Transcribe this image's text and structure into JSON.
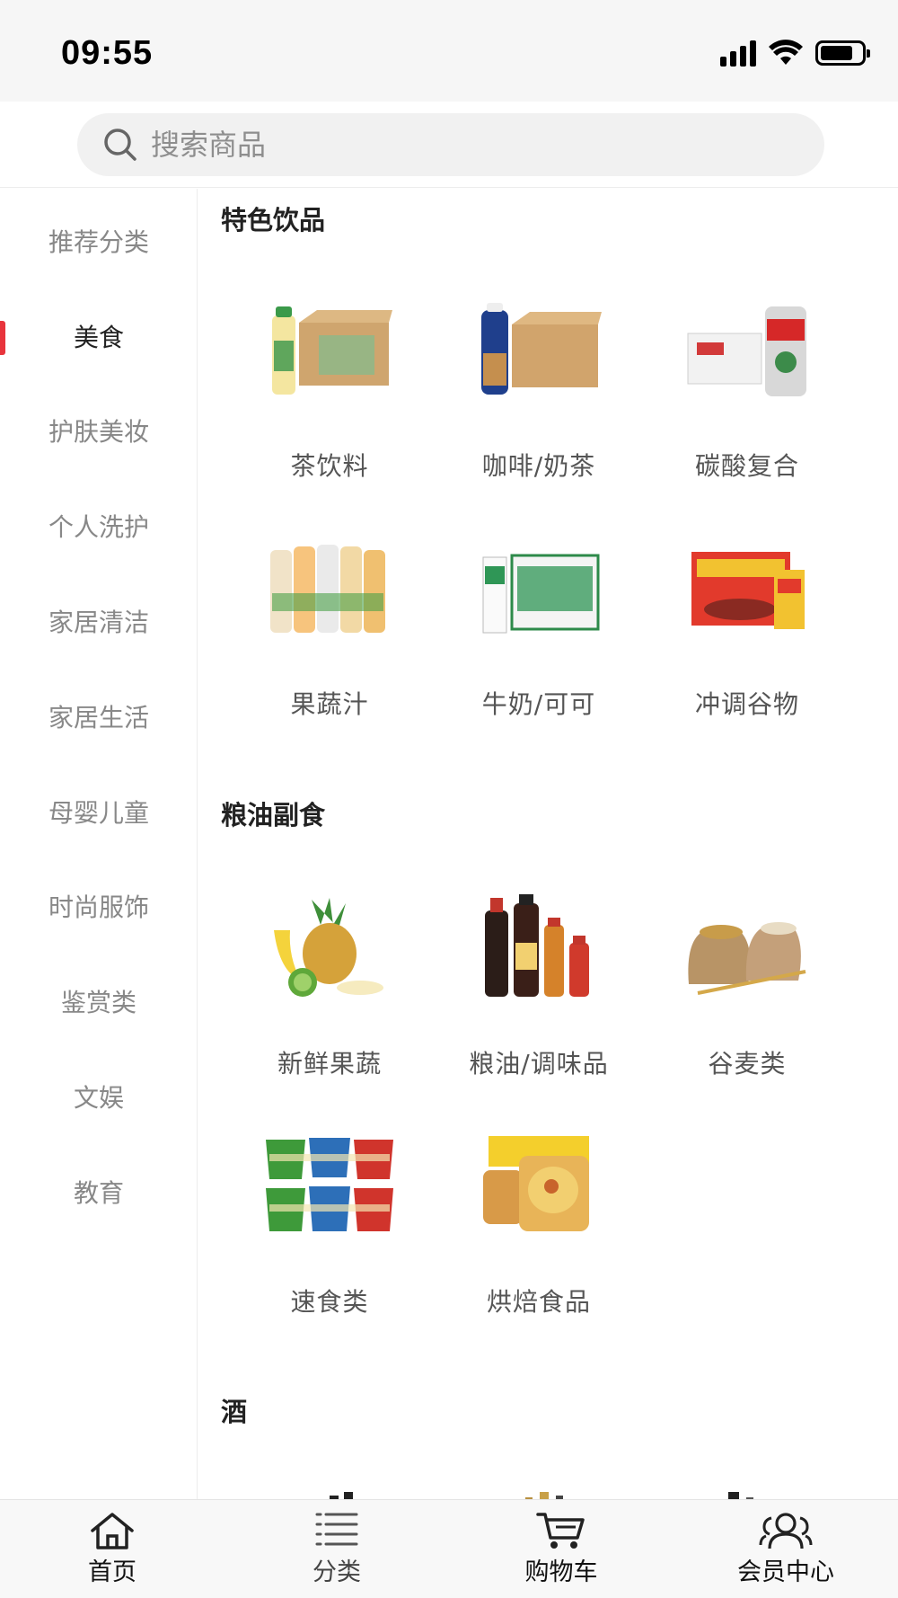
{
  "status_bar": {
    "time": "09:55"
  },
  "search": {
    "placeholder": "搜索商品"
  },
  "sidebar": {
    "items": [
      {
        "label": "推荐分类",
        "active": false
      },
      {
        "label": "美食",
        "active": true
      },
      {
        "label": "护肤美妆",
        "active": false
      },
      {
        "label": "个人洗护",
        "active": false
      },
      {
        "label": "家居清洁",
        "active": false
      },
      {
        "label": "家居生活",
        "active": false
      },
      {
        "label": "母婴儿童",
        "active": false
      },
      {
        "label": "时尚服饰",
        "active": false
      },
      {
        "label": "鉴赏类",
        "active": false
      },
      {
        "label": "文娱",
        "active": false
      },
      {
        "label": "教育",
        "active": false
      }
    ]
  },
  "sections": [
    {
      "title": "特色饮品",
      "products": [
        {
          "label": "茶饮料",
          "icon": "tea-drink-image"
        },
        {
          "label": "咖啡/奶茶",
          "icon": "coffee-milk-tea-image"
        },
        {
          "label": "碳酸复合",
          "icon": "carbonated-drink-image"
        },
        {
          "label": "果蔬汁",
          "icon": "fruit-juice-image"
        },
        {
          "label": "牛奶/可可",
          "icon": "milk-cocoa-image"
        },
        {
          "label": "冲调谷物",
          "icon": "cereal-image"
        }
      ]
    },
    {
      "title": "粮油副食",
      "products": [
        {
          "label": "新鲜果蔬",
          "icon": "fresh-fruit-image"
        },
        {
          "label": "粮油/调味品",
          "icon": "condiments-image"
        },
        {
          "label": "谷麦类",
          "icon": "grain-image"
        },
        {
          "label": "速食类",
          "icon": "instant-noodle-image"
        },
        {
          "label": "烘焙食品",
          "icon": "bakery-image"
        }
      ]
    },
    {
      "title": "酒",
      "products": []
    }
  ],
  "tabbar": {
    "tabs": [
      {
        "label": "首页",
        "icon": "home-icon"
      },
      {
        "label": "分类",
        "icon": "list-icon"
      },
      {
        "label": "购物车",
        "icon": "cart-icon"
      },
      {
        "label": "会员中心",
        "icon": "member-icon"
      }
    ]
  },
  "colors": {
    "accent": "#e8343c",
    "sidebar_text": "#888888",
    "title_text": "#222222"
  }
}
